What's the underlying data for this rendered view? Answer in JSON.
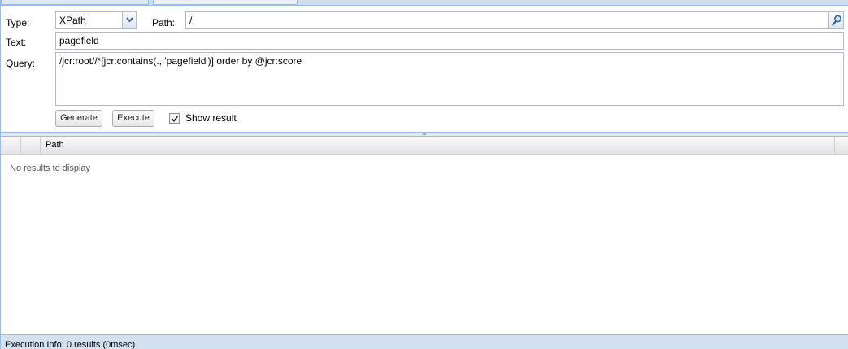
{
  "form": {
    "type_label": "Type:",
    "type_value": "XPath",
    "path_label": "Path:",
    "path_value": "/",
    "text_label": "Text:",
    "text_value": "pagefield",
    "query_label": "Query:",
    "query_value": "/jcr:root//*[jcr:contains(., 'pagefield')] order by @jcr:score",
    "generate_label": "Generate",
    "execute_label": "Execute",
    "show_result_label": "Show result",
    "show_result_checked": true
  },
  "grid": {
    "columns": [
      "",
      "Path"
    ],
    "empty_text": "No results to display"
  },
  "status": {
    "text": "Execution Info: 0 results (0msec)"
  },
  "icons": {
    "type_trigger": "chevron-down-icon",
    "path_trigger": "search-icon",
    "checkbox": "checkmark-icon"
  },
  "colors": {
    "panel_border": "#99bbe8",
    "status_bg": "#d3e1f1"
  }
}
